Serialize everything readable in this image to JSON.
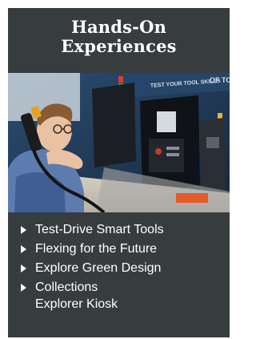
{
  "panel": {
    "title_line1": "Hands-On",
    "title_line2": "Experiences"
  },
  "photo": {
    "sign_text": "TEST YOUR TOOL SKILLS",
    "sign_text_right": "OF TO"
  },
  "list": {
    "items": [
      {
        "label": "Test-Drive Smart Tools"
      },
      {
        "label": "Flexing for the Future"
      },
      {
        "label": "Explore Green Design"
      },
      {
        "label_line1": "Collections",
        "label_line2": "Explorer Kiosk"
      }
    ]
  },
  "colors": {
    "panel_background": "#373c3f",
    "text": "#ffffff",
    "photo_wall": "#1f3a55"
  }
}
